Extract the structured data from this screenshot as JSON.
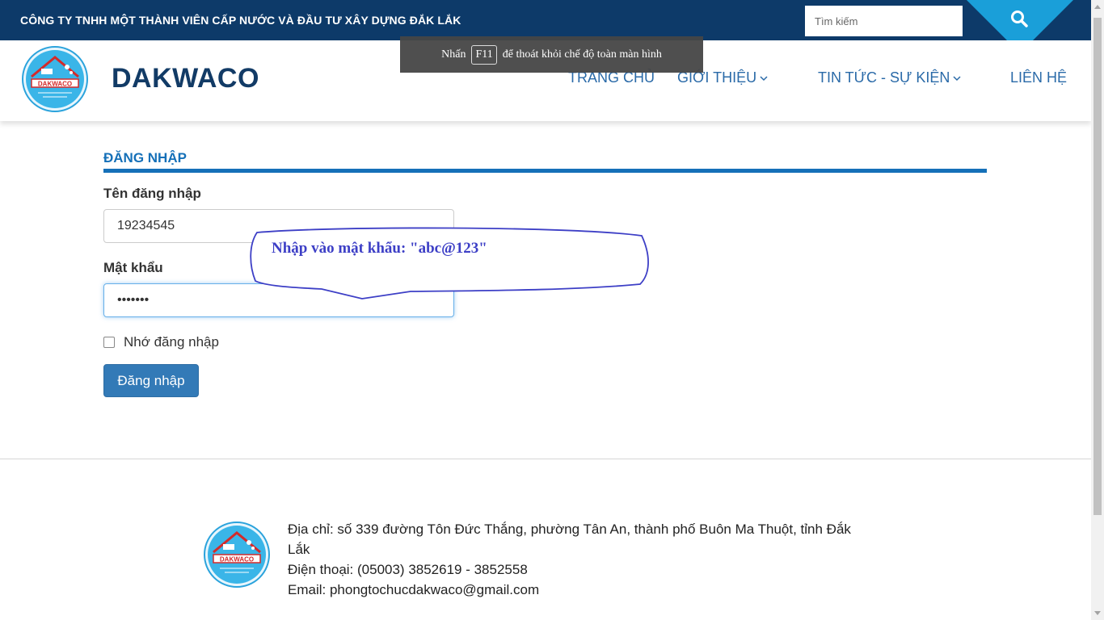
{
  "topbar": {
    "company_name": "CÔNG TY TNHH MỘT THÀNH VIÊN CẤP NƯỚC VÀ ĐẦU TƯ XÂY DỰNG ĐẮK LẮK",
    "search_placeholder": "Tìm kiếm"
  },
  "header": {
    "brand": "DAKWACO",
    "logo_text": "DAKWACO",
    "nav": [
      {
        "label": "TRANG CHỦ"
      },
      {
        "label": "GIỚI THIỆU"
      },
      {
        "label": "TIN TỨC - SỰ KIỆN"
      },
      {
        "label": "LIÊN HỆ"
      }
    ]
  },
  "fullscreen_notice": {
    "before": "Nhấn",
    "key": "F11",
    "after": "để thoát khỏi chế độ toàn màn hình"
  },
  "login": {
    "heading": "ĐĂNG NHẬP",
    "username_label": "Tên đăng nhập",
    "username_value": "19234545",
    "password_label": "Mật khẩu",
    "password_value": "•••••••",
    "remember_label": "Nhớ đăng nhập",
    "submit_label": "Đăng nhập"
  },
  "callout": {
    "text": "Nhập vào mật khẩu: \"abc@123\""
  },
  "footer": {
    "address_line1": "Địa chỉ: số 339 đường Tôn Đức Thắng, phường Tân An, thành phố Buôn Ma Thuột, tỉnh Đắk",
    "address_line2": "Lắk",
    "phone": "Điện thoại: (05003) 3852619 - 3852558",
    "email": "Email: phongtochucdakwaco@gmail.com"
  },
  "colors": {
    "topbar_bg": "#0d3a69",
    "accent_blue": "#1570b8",
    "search_blue": "#1a9fd9",
    "button_blue": "#337ab7",
    "callout_text": "#3d3fc6"
  }
}
